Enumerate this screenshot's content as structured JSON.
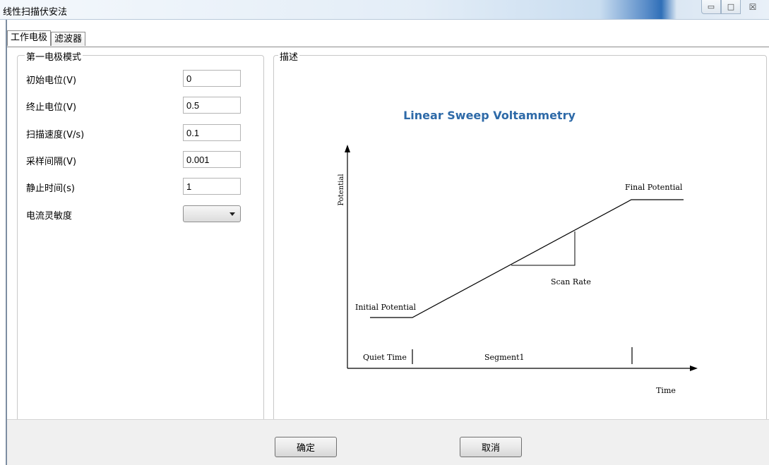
{
  "window": {
    "title": "线性扫描伏安法",
    "buttons": {
      "minimize": "▭",
      "maximize": "□",
      "close": "☒"
    }
  },
  "tabs": [
    {
      "label": "工作电极",
      "active": true
    },
    {
      "label": "滤波器",
      "active": false
    }
  ],
  "electrode_group": {
    "title": "第一电极模式",
    "params": [
      {
        "label": "初始电位(V)",
        "value": "0"
      },
      {
        "label": "终止电位(V)",
        "value": "0.5"
      },
      {
        "label": "扫描速度(V/s)",
        "value": "0.1"
      },
      {
        "label": "采样间隔(V)",
        "value": "0.001"
      },
      {
        "label": "静止时间(s)",
        "value": "1"
      }
    ],
    "sensitivity": {
      "label": "电流灵敏度",
      "value": ""
    }
  },
  "description_group": {
    "title": "描述",
    "diagram": {
      "title": "Linear Sweep Voltammetry",
      "title_color": "#2e6aa8",
      "y_label": "Potential",
      "x_label": "Time",
      "initial_label": "Initial Potential",
      "final_label": "Final Potential",
      "scan_rate_label": "Scan Rate",
      "quiet_time_label": "Quiet Time",
      "segment_label": "Segment1"
    }
  },
  "footer": {
    "ok_label": "确定",
    "cancel_label": "取消"
  }
}
